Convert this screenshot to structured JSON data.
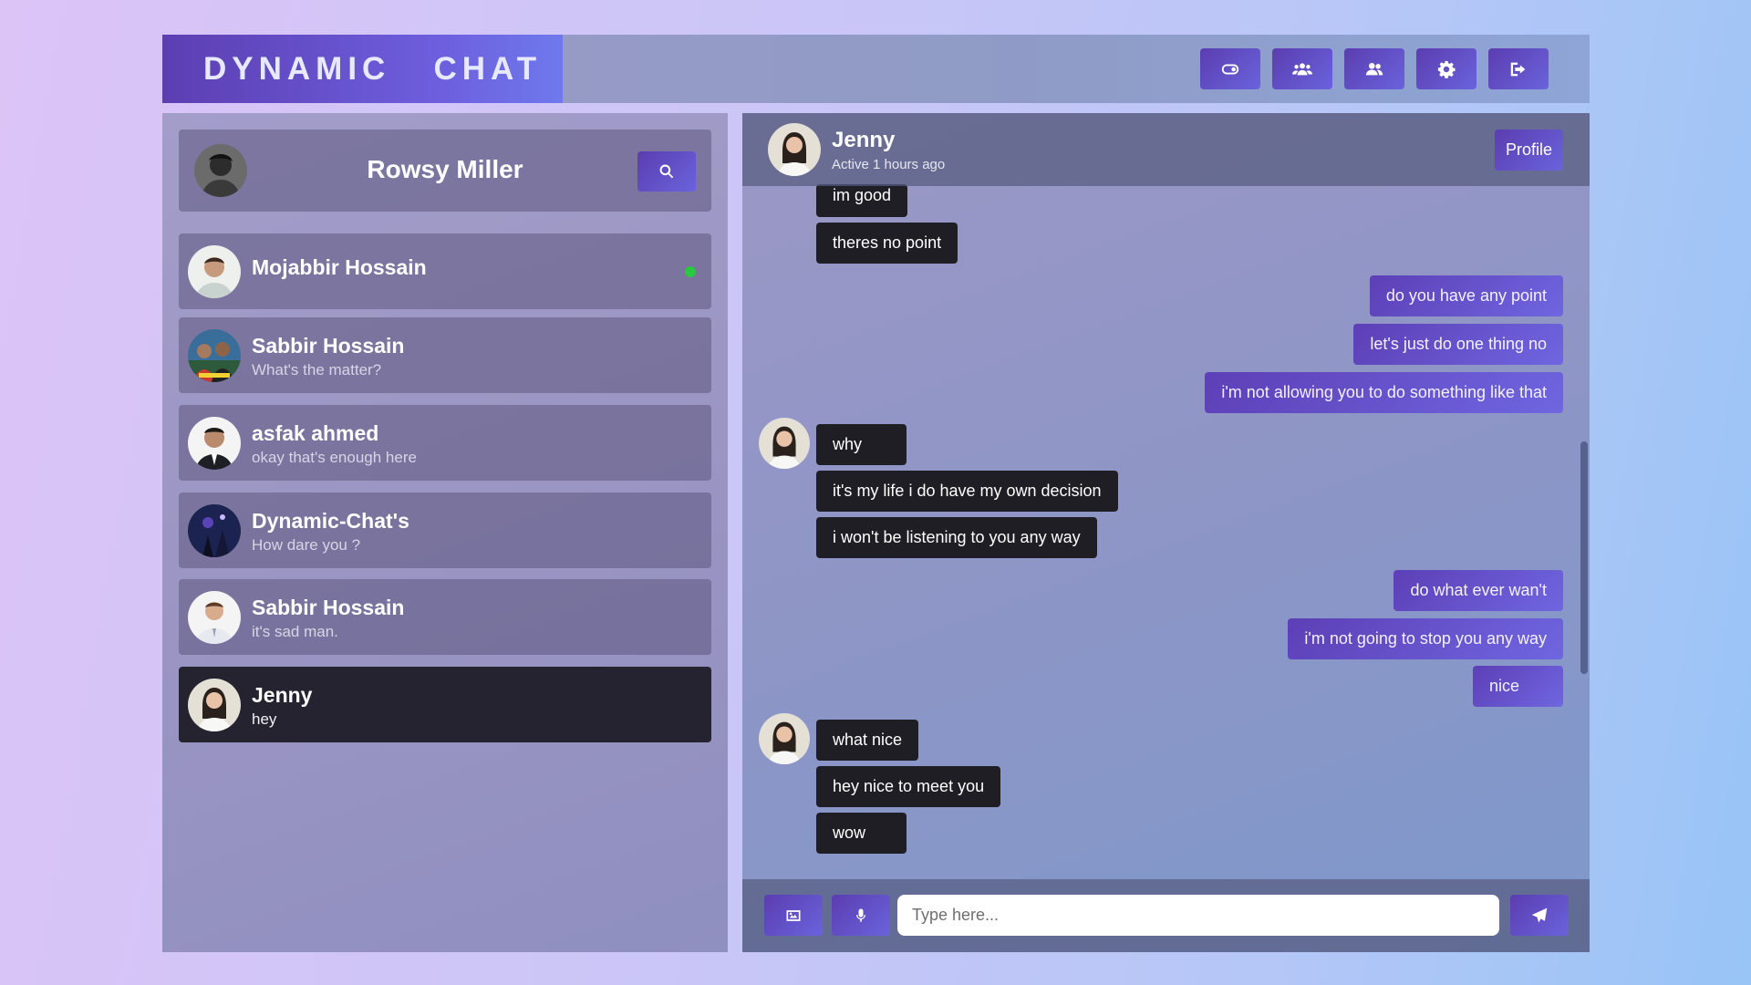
{
  "app": {
    "logo_text": "DYNAMIC   CHAT",
    "header_buttons": [
      "toggle-icon",
      "users-group-icon",
      "users-icon",
      "gear-icon",
      "logout-icon"
    ]
  },
  "sidebar": {
    "current_user": "Rowsy Miller",
    "contacts": [
      {
        "name": "Mojabbir Hossain",
        "last_message": "",
        "online": true
      },
      {
        "name": "Sabbir Hossain",
        "last_message": "What's the matter?"
      },
      {
        "name": "asfak ahmed",
        "last_message": "okay that's enough here"
      },
      {
        "name": "Dynamic-Chat's",
        "last_message": "How dare you ?"
      },
      {
        "name": "Sabbir Hossain",
        "last_message": "it's sad man."
      },
      {
        "name": "Jenny",
        "last_message": "hey",
        "active": true
      }
    ]
  },
  "chat": {
    "name": "Jenny",
    "status": "Active 1 hours ago",
    "profile_label": "Profile",
    "messages": [
      {
        "dir": "in",
        "text": "im good"
      },
      {
        "dir": "in",
        "text": "theres no point"
      },
      {
        "dir": "out",
        "text": "do you have any point"
      },
      {
        "dir": "out",
        "text": "let's just do one thing no"
      },
      {
        "dir": "out",
        "text": "i'm not allowing you to do something like that"
      },
      {
        "dir": "in",
        "text": "why"
      },
      {
        "dir": "in",
        "text": "it's my life i do have my own decision"
      },
      {
        "dir": "in",
        "text": "i won't be listening to you any way"
      },
      {
        "dir": "out",
        "text": "do what ever wan't"
      },
      {
        "dir": "out",
        "text": "i'm not going to stop you any way"
      },
      {
        "dir": "out",
        "text": "nice"
      },
      {
        "dir": "in",
        "text": "what nice"
      },
      {
        "dir": "in",
        "text": "hey nice to meet you"
      },
      {
        "dir": "in",
        "text": "wow"
      }
    ],
    "input_placeholder": "Type here...",
    "composer_icons": [
      "image-icon",
      "microphone-icon",
      "send-icon"
    ]
  },
  "colors": {
    "accent": "#5b3db0",
    "accent_light": "#6a63dc",
    "incoming_bubble": "#1f1e25",
    "online": "#28c940"
  }
}
